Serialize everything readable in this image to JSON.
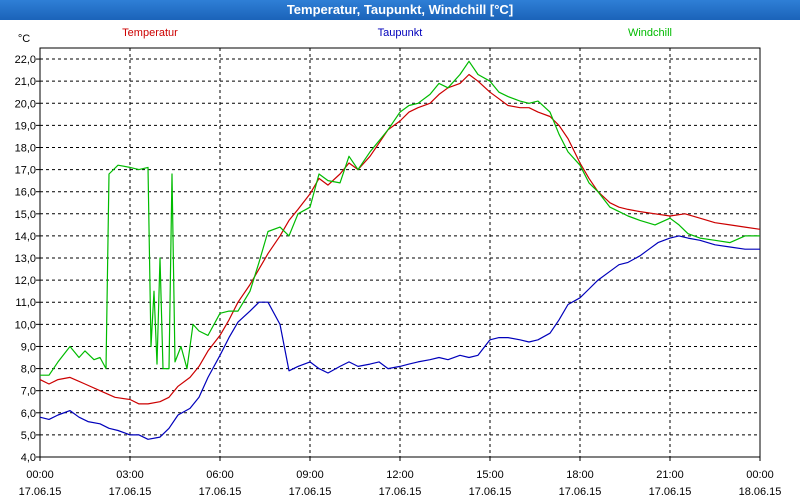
{
  "window": {
    "title": "Temperatur, Taupunkt, Windchill [°C]"
  },
  "colors": {
    "temperature": "#cc0000",
    "dewpoint": "#0000bb",
    "windchill": "#00bb00",
    "grid": "#000000"
  },
  "chart_data": {
    "type": "line",
    "title": "Temperatur, Taupunkt, Windchill [°C]",
    "ylabel": "°C",
    "ylim": [
      4.0,
      22.5
    ],
    "y_ticks": [
      "4,0",
      "5,0",
      "6,0",
      "7,0",
      "8,0",
      "9,0",
      "10,0",
      "11,0",
      "12,0",
      "13,0",
      "14,0",
      "15,0",
      "16,0",
      "17,0",
      "18,0",
      "19,0",
      "20,0",
      "21,0",
      "22,0"
    ],
    "x_ticks": [
      {
        "time": "00:00",
        "date": "17.06.15"
      },
      {
        "time": "03:00",
        "date": "17.06.15"
      },
      {
        "time": "06:00",
        "date": "17.06.15"
      },
      {
        "time": "09:00",
        "date": "17.06.15"
      },
      {
        "time": "12:00",
        "date": "17.06.15"
      },
      {
        "time": "15:00",
        "date": "17.06.15"
      },
      {
        "time": "18:00",
        "date": "17.06.15"
      },
      {
        "time": "21:00",
        "date": "17.06.15"
      },
      {
        "time": "00:00",
        "date": "18.06.15"
      }
    ],
    "grid": true,
    "series": [
      {
        "name": "Temperatur",
        "color": "#cc0000",
        "points": [
          [
            0,
            7.5
          ],
          [
            0.3,
            7.3
          ],
          [
            0.6,
            7.5
          ],
          [
            1,
            7.6
          ],
          [
            1.5,
            7.3
          ],
          [
            2,
            7.0
          ],
          [
            2.5,
            6.7
          ],
          [
            3,
            6.6
          ],
          [
            3.3,
            6.4
          ],
          [
            3.6,
            6.4
          ],
          [
            4,
            6.5
          ],
          [
            4.3,
            6.7
          ],
          [
            4.6,
            7.2
          ],
          [
            5,
            7.6
          ],
          [
            5.3,
            8.1
          ],
          [
            5.6,
            8.8
          ],
          [
            6,
            9.5
          ],
          [
            6.3,
            10.2
          ],
          [
            6.6,
            11.0
          ],
          [
            7,
            11.8
          ],
          [
            7.3,
            12.5
          ],
          [
            7.6,
            13.2
          ],
          [
            8,
            14.0
          ],
          [
            8.3,
            14.7
          ],
          [
            8.6,
            15.2
          ],
          [
            9,
            15.9
          ],
          [
            9.3,
            16.6
          ],
          [
            9.6,
            16.3
          ],
          [
            10,
            16.8
          ],
          [
            10.3,
            17.3
          ],
          [
            10.6,
            17.0
          ],
          [
            11,
            17.6
          ],
          [
            11.3,
            18.2
          ],
          [
            11.6,
            18.8
          ],
          [
            12,
            19.2
          ],
          [
            12.3,
            19.6
          ],
          [
            12.6,
            19.8
          ],
          [
            13,
            20.0
          ],
          [
            13.3,
            20.4
          ],
          [
            13.6,
            20.7
          ],
          [
            14,
            20.9
          ],
          [
            14.3,
            21.3
          ],
          [
            14.6,
            21.0
          ],
          [
            15,
            20.5
          ],
          [
            15.3,
            20.2
          ],
          [
            15.6,
            19.9
          ],
          [
            16,
            19.8
          ],
          [
            16.3,
            19.8
          ],
          [
            16.6,
            19.6
          ],
          [
            17,
            19.4
          ],
          [
            17.3,
            19.0
          ],
          [
            17.6,
            18.4
          ],
          [
            18,
            17.3
          ],
          [
            18.3,
            16.6
          ],
          [
            18.6,
            16.0
          ],
          [
            19,
            15.5
          ],
          [
            19.3,
            15.3
          ],
          [
            19.6,
            15.2
          ],
          [
            20,
            15.1
          ],
          [
            20.5,
            15.0
          ],
          [
            21,
            14.9
          ],
          [
            21.5,
            15.0
          ],
          [
            22,
            14.8
          ],
          [
            22.5,
            14.6
          ],
          [
            23,
            14.5
          ],
          [
            23.5,
            14.4
          ],
          [
            24,
            14.3
          ]
        ]
      },
      {
        "name": "Taupunkt",
        "color": "#0000bb",
        "points": [
          [
            0,
            5.8
          ],
          [
            0.3,
            5.7
          ],
          [
            0.6,
            5.9
          ],
          [
            1,
            6.1
          ],
          [
            1.3,
            5.8
          ],
          [
            1.6,
            5.6
          ],
          [
            2,
            5.5
          ],
          [
            2.3,
            5.3
          ],
          [
            2.6,
            5.2
          ],
          [
            3,
            5.0
          ],
          [
            3.3,
            5.0
          ],
          [
            3.6,
            4.8
          ],
          [
            4,
            4.9
          ],
          [
            4.3,
            5.3
          ],
          [
            4.6,
            5.9
          ],
          [
            5,
            6.2
          ],
          [
            5.3,
            6.7
          ],
          [
            5.6,
            7.6
          ],
          [
            6,
            8.6
          ],
          [
            6.3,
            9.4
          ],
          [
            6.6,
            10.1
          ],
          [
            7,
            10.6
          ],
          [
            7.3,
            11.0
          ],
          [
            7.6,
            11.0
          ],
          [
            8,
            10.0
          ],
          [
            8.3,
            7.9
          ],
          [
            8.6,
            8.1
          ],
          [
            9,
            8.3
          ],
          [
            9.3,
            8.0
          ],
          [
            9.6,
            7.8
          ],
          [
            10,
            8.1
          ],
          [
            10.3,
            8.3
          ],
          [
            10.6,
            8.1
          ],
          [
            11,
            8.2
          ],
          [
            11.3,
            8.3
          ],
          [
            11.6,
            8.0
          ],
          [
            12,
            8.1
          ],
          [
            12.3,
            8.2
          ],
          [
            12.6,
            8.3
          ],
          [
            13,
            8.4
          ],
          [
            13.3,
            8.5
          ],
          [
            13.6,
            8.4
          ],
          [
            14,
            8.6
          ],
          [
            14.3,
            8.5
          ],
          [
            14.6,
            8.6
          ],
          [
            15,
            9.3
          ],
          [
            15.3,
            9.4
          ],
          [
            15.6,
            9.4
          ],
          [
            16,
            9.3
          ],
          [
            16.3,
            9.2
          ],
          [
            16.6,
            9.3
          ],
          [
            17,
            9.6
          ],
          [
            17.3,
            10.2
          ],
          [
            17.6,
            10.9
          ],
          [
            18,
            11.2
          ],
          [
            18.3,
            11.6
          ],
          [
            18.6,
            12.0
          ],
          [
            19,
            12.4
          ],
          [
            19.3,
            12.7
          ],
          [
            19.6,
            12.8
          ],
          [
            20,
            13.1
          ],
          [
            20.3,
            13.4
          ],
          [
            20.6,
            13.7
          ],
          [
            21,
            13.9
          ],
          [
            21.3,
            14.0
          ],
          [
            21.6,
            13.9
          ],
          [
            22,
            13.8
          ],
          [
            22.5,
            13.6
          ],
          [
            23,
            13.5
          ],
          [
            23.5,
            13.4
          ],
          [
            24,
            13.4
          ]
        ]
      },
      {
        "name": "Windchill",
        "color": "#00bb00",
        "points": [
          [
            0,
            7.7
          ],
          [
            0.3,
            7.7
          ],
          [
            0.6,
            8.3
          ],
          [
            1,
            9.0
          ],
          [
            1.3,
            8.5
          ],
          [
            1.5,
            8.8
          ],
          [
            1.8,
            8.4
          ],
          [
            2,
            8.5
          ],
          [
            2.2,
            8.0
          ],
          [
            2.3,
            16.8
          ],
          [
            2.6,
            17.2
          ],
          [
            3,
            17.1
          ],
          [
            3.3,
            17.0
          ],
          [
            3.6,
            17.1
          ],
          [
            3.7,
            9.0
          ],
          [
            3.8,
            11.5
          ],
          [
            3.9,
            8.2
          ],
          [
            4.0,
            13.0
          ],
          [
            4.1,
            8.0
          ],
          [
            4.3,
            8.0
          ],
          [
            4.4,
            16.8
          ],
          [
            4.5,
            8.3
          ],
          [
            4.7,
            9.0
          ],
          [
            4.9,
            8.0
          ],
          [
            5.1,
            10.0
          ],
          [
            5.3,
            9.7
          ],
          [
            5.6,
            9.5
          ],
          [
            6,
            10.5
          ],
          [
            6.3,
            10.6
          ],
          [
            6.6,
            10.6
          ],
          [
            7,
            11.5
          ],
          [
            7.3,
            12.8
          ],
          [
            7.6,
            14.2
          ],
          [
            8,
            14.4
          ],
          [
            8.3,
            14.0
          ],
          [
            8.6,
            15.0
          ],
          [
            9,
            15.3
          ],
          [
            9.3,
            16.8
          ],
          [
            9.6,
            16.5
          ],
          [
            10,
            16.4
          ],
          [
            10.3,
            17.6
          ],
          [
            10.6,
            17.0
          ],
          [
            11,
            17.8
          ],
          [
            11.3,
            18.3
          ],
          [
            11.6,
            18.8
          ],
          [
            12,
            19.6
          ],
          [
            12.3,
            19.9
          ],
          [
            12.6,
            20.0
          ],
          [
            13,
            20.4
          ],
          [
            13.3,
            20.9
          ],
          [
            13.6,
            20.7
          ],
          [
            14,
            21.3
          ],
          [
            14.3,
            21.9
          ],
          [
            14.6,
            21.3
          ],
          [
            15,
            21.0
          ],
          [
            15.3,
            20.5
          ],
          [
            15.6,
            20.3
          ],
          [
            16,
            20.1
          ],
          [
            16.3,
            20.0
          ],
          [
            16.6,
            20.1
          ],
          [
            17,
            19.6
          ],
          [
            17.3,
            18.6
          ],
          [
            17.6,
            17.8
          ],
          [
            18,
            17.2
          ],
          [
            18.3,
            16.4
          ],
          [
            18.6,
            16.0
          ],
          [
            19,
            15.3
          ],
          [
            19.3,
            15.1
          ],
          [
            19.6,
            14.9
          ],
          [
            20,
            14.7
          ],
          [
            20.5,
            14.5
          ],
          [
            21,
            14.8
          ],
          [
            21.3,
            14.5
          ],
          [
            21.6,
            14.1
          ],
          [
            22,
            13.9
          ],
          [
            22.5,
            13.8
          ],
          [
            23,
            13.7
          ],
          [
            23.5,
            14.0
          ],
          [
            24,
            14.0
          ]
        ]
      }
    ]
  }
}
